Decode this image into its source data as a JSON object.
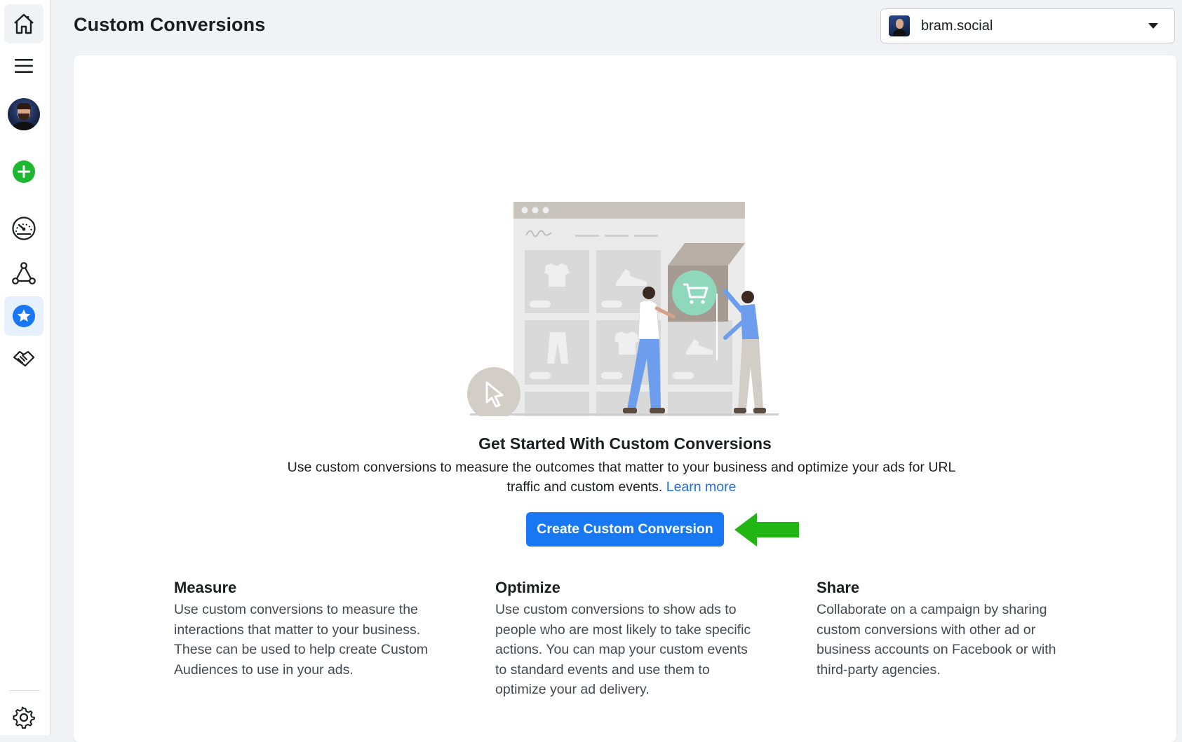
{
  "page": {
    "title": "Custom Conversions"
  },
  "account": {
    "name": "bram.social"
  },
  "rail": {
    "items": [
      {
        "icon": "home-icon"
      },
      {
        "icon": "menu-icon"
      },
      {
        "icon": "profile-avatar"
      },
      {
        "icon": "plus-circle-icon",
        "color": "#1db82f"
      },
      {
        "icon": "gauge-icon"
      },
      {
        "icon": "network-icon"
      },
      {
        "icon": "star-circle-icon",
        "color": "#1877f2",
        "selected": true
      },
      {
        "icon": "handshake-icon"
      },
      {
        "icon": "gear-icon"
      }
    ]
  },
  "empty_state": {
    "headline": "Get Started With Custom Conversions",
    "description": "Use custom conversions to measure the outcomes that matter to your business and optimize your ads for URL traffic and custom events.",
    "learn_more": "Learn more",
    "cta_label": "Create Custom Conversion"
  },
  "features": [
    {
      "title": "Measure",
      "text": "Use custom conversions to measure the interactions that matter to your business. These can be used to help create Custom Audiences to use in your ads."
    },
    {
      "title": "Optimize",
      "text": "Use custom conversions to show ads to people who are most likely to take specific actions. You can map your custom events to standard events and use them to optimize your ad delivery."
    },
    {
      "title": "Share",
      "text": "Collaborate on a campaign by sharing custom conversions with other ad or business accounts on Facebook or with third-party agencies."
    }
  ],
  "colors": {
    "primary": "#1877f2",
    "link": "#216fdb",
    "arrow": "#22b614",
    "background": "#f0f2f5"
  }
}
